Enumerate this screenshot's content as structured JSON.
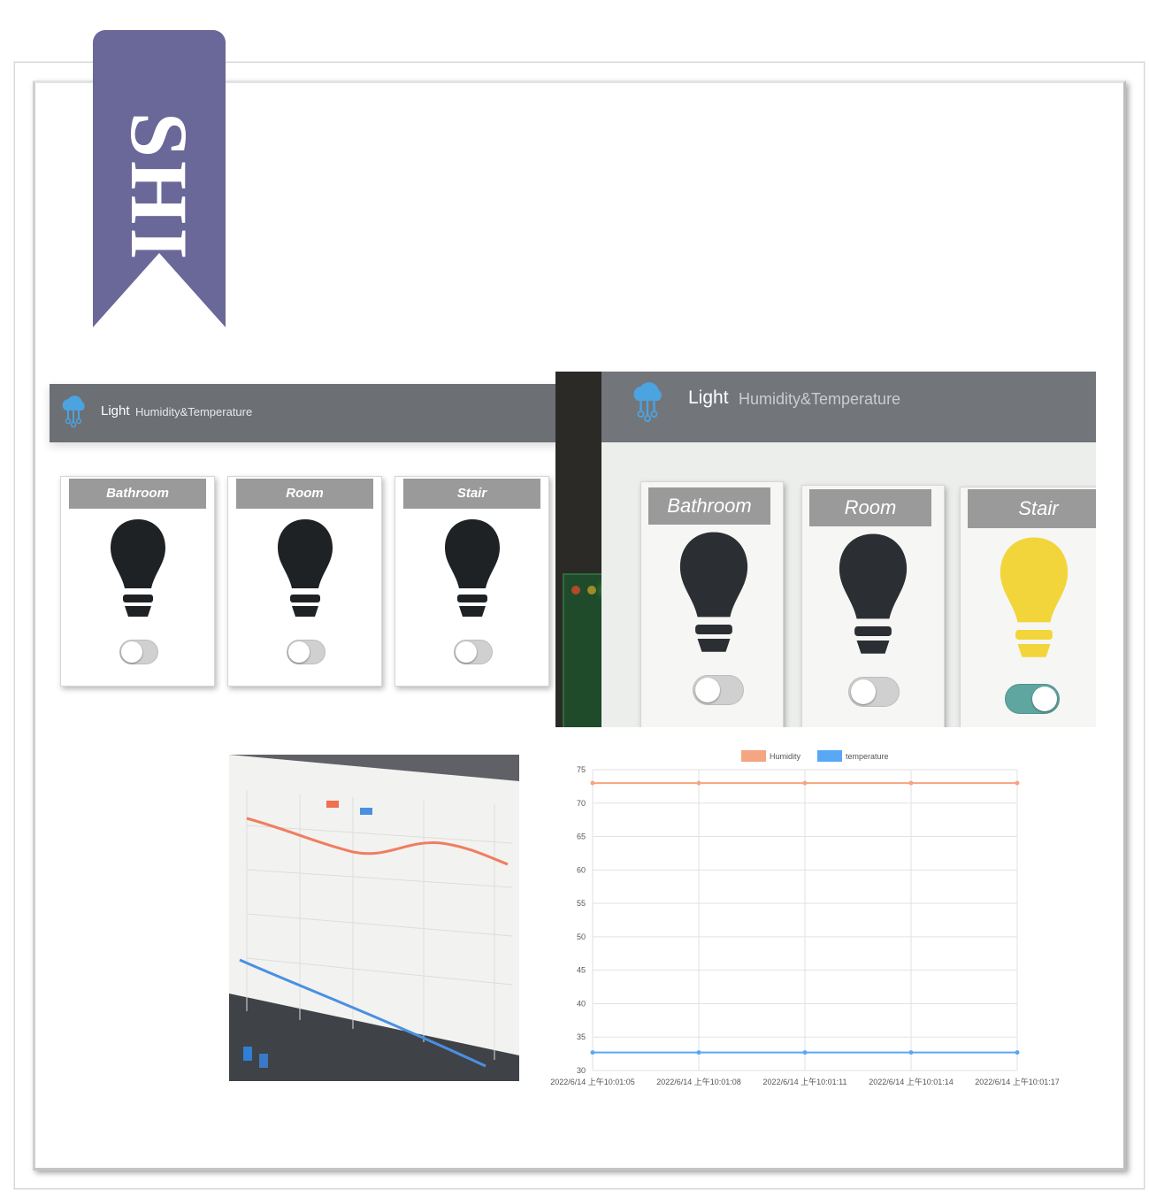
{
  "ribbon": {
    "text": "SHI",
    "color": "#6a6799"
  },
  "screenshot": {
    "nav": {
      "logo_icon": "cloud-icon",
      "light_label": "Light",
      "humtemp_label": "Humidity&Temperature"
    },
    "cards": [
      {
        "title": "Bathroom",
        "bulb_icon": "lightbulb-icon",
        "on": false
      },
      {
        "title": "Room",
        "bulb_icon": "lightbulb-icon",
        "on": false
      },
      {
        "title": "Stair",
        "bulb_icon": "lightbulb-icon",
        "on": false
      }
    ]
  },
  "photo_screen": {
    "nav": {
      "light_label": "Light",
      "humtemp_label": "Humidity&Temperature"
    },
    "cards": [
      {
        "title": "Bathroom",
        "on": false
      },
      {
        "title": "Room",
        "on": false
      },
      {
        "title": "Stair",
        "on": true
      }
    ],
    "bulb_off_color": "#2b2f33",
    "bulb_on_color": "#f2d53a",
    "toggle_on_color": "#5fa6a0"
  },
  "chart_data": {
    "type": "line",
    "x": [
      "2022/6/14 上午10:01:05",
      "2022/6/14 上午10:01:08",
      "2022/6/14 上午10:01:11",
      "2022/6/14 上午10:01:14",
      "2022/6/14 上午10:01:17"
    ],
    "series": [
      {
        "name": "Humidity",
        "color": "#f4a582",
        "values": [
          73,
          73,
          73,
          73,
          73
        ]
      },
      {
        "name": "temperature",
        "color": "#59a8f5",
        "values": [
          32.7,
          32.7,
          32.7,
          32.7,
          32.7
        ]
      }
    ],
    "ylim": [
      30,
      75
    ],
    "yticks": [
      75,
      70,
      65,
      60,
      55,
      50,
      45,
      40,
      35,
      30
    ],
    "grid": true,
    "legend": "top"
  }
}
